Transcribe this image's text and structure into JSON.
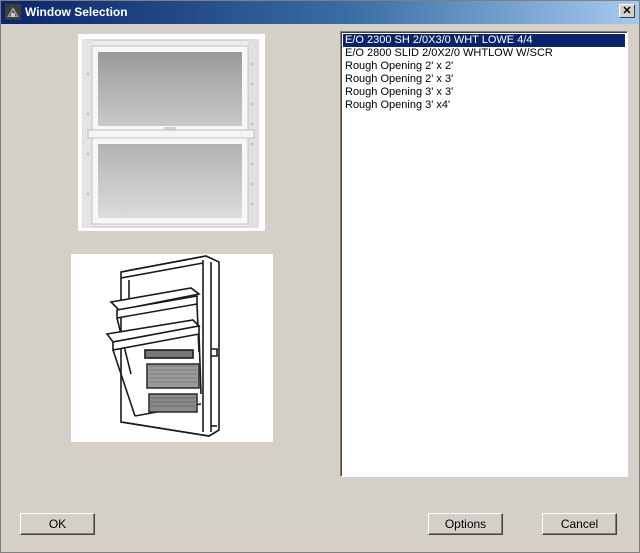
{
  "window": {
    "title": "Window Selection",
    "close_glyph": "✕"
  },
  "images": {
    "top": "double-hung-window-photo",
    "bottom": "tilt-sash-window-drawing"
  },
  "list": {
    "items": [
      {
        "label": "E/O 2300 SH 2/0X3/0 WHT LOWE 4/4",
        "selected": true
      },
      {
        "label": "E/O 2800 SLID 2/0X2/0 WHTLOW W/SCR",
        "selected": false
      },
      {
        "label": "Rough Opening 2' x 2'",
        "selected": false
      },
      {
        "label": "Rough Opening 2' x 3'",
        "selected": false
      },
      {
        "label": "Rough Opening 3' x 3'",
        "selected": false
      },
      {
        "label": "Rough Opening 3' x4'",
        "selected": false
      }
    ]
  },
  "buttons": {
    "ok": "OK",
    "options": "Options",
    "cancel": "Cancel"
  },
  "colors": {
    "face": "#d4d0c8",
    "title_start": "#0a246a",
    "title_end": "#a6caf0",
    "selection": "#0a246a"
  }
}
